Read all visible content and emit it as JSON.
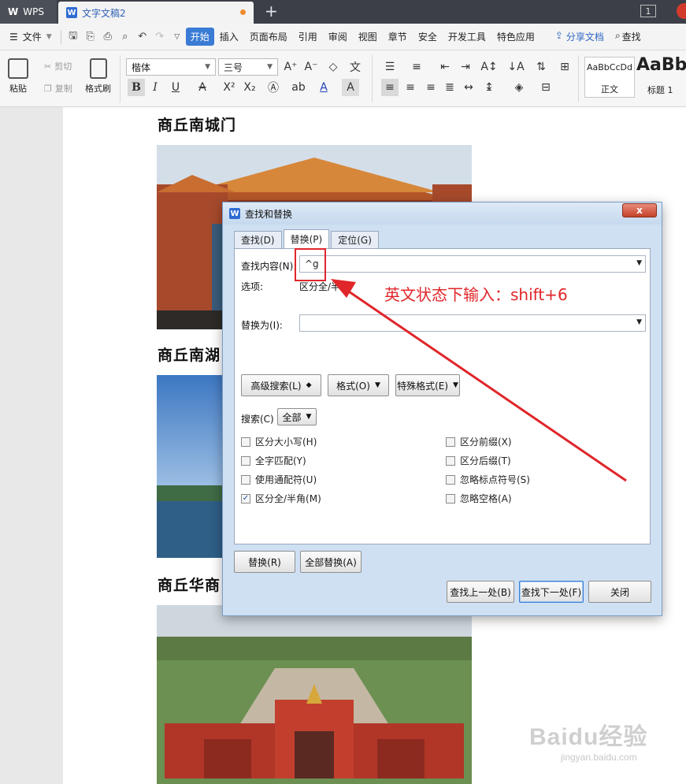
{
  "titlebar": {
    "app_tab": "WPS",
    "doc_tab": "文字文稿2",
    "window_count": "1"
  },
  "menubar": {
    "file": "文件",
    "tabs": [
      "开始",
      "插入",
      "页面布局",
      "引用",
      "审阅",
      "视图",
      "章节",
      "安全",
      "开发工具",
      "特色应用"
    ],
    "active_tab": "开始",
    "share": "分享文档",
    "search": "查找"
  },
  "ribbon": {
    "paste": "粘贴",
    "cut": "剪切",
    "copy": "复制",
    "format_painter": "格式刷",
    "font_name": "楷体",
    "font_size": "三号",
    "style_normal_preview": "AaBbCcDd",
    "style_normal": "正文",
    "style_heading_preview": "AaBb",
    "style_heading": "标题 1"
  },
  "document": {
    "headings": [
      "商丘南城门",
      "商丘南湖",
      "商丘华商"
    ]
  },
  "dialog": {
    "title": "查找和替换",
    "close": "x",
    "tabs": [
      "查找(D)",
      "替换(P)",
      "定位(G)"
    ],
    "active_tab": "替换(P)",
    "find_label": "查找内容(N):",
    "find_value": "^g",
    "options_label": "选项:",
    "options_value": "区分全/半角",
    "replace_label": "替换为(I):",
    "replace_value": "",
    "advanced_search": "高级搜索(L)",
    "format": "格式(O)",
    "special_format": "特殊格式(E)",
    "search_label": "搜索(C)",
    "search_scope": "全部",
    "checkboxes_left": [
      {
        "label": "区分大小写(H)",
        "checked": false
      },
      {
        "label": "全字匹配(Y)",
        "checked": false
      },
      {
        "label": "使用通配符(U)",
        "checked": false
      },
      {
        "label": "区分全/半角(M)",
        "checked": true
      }
    ],
    "checkboxes_right": [
      {
        "label": "区分前缀(X)",
        "checked": false
      },
      {
        "label": "区分后缀(T)",
        "checked": false
      },
      {
        "label": "忽略标点符号(S)",
        "checked": false
      },
      {
        "label": "忽略空格(A)",
        "checked": false
      }
    ],
    "replace_btn": "替换(R)",
    "replace_all_btn": "全部替换(A)",
    "find_prev_btn": "查找上一处(B)",
    "find_next_btn": "查找下一处(F)",
    "close_btn": "关闭"
  },
  "annotation": {
    "text": "英文状态下输入：shift+6",
    "color": "#e0262a"
  },
  "watermark": {
    "brand": "Baidu经验",
    "url": "jingyan.baidu.com"
  }
}
